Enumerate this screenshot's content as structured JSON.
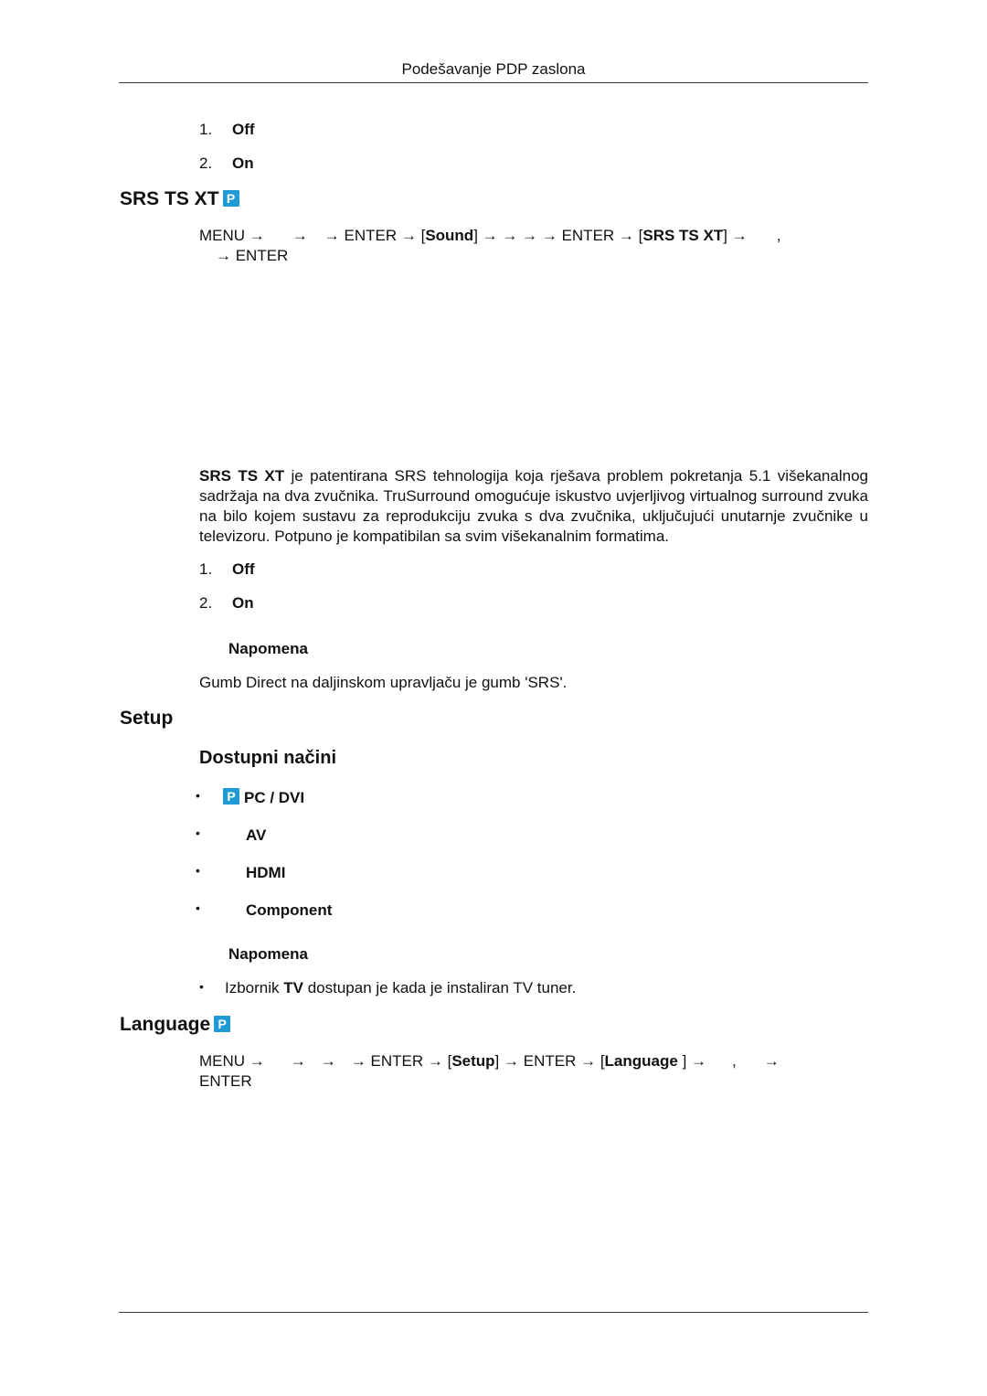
{
  "header": {
    "title": "Podešavanje PDP zaslona"
  },
  "top_options": [
    {
      "num": "1.",
      "label": "Off"
    },
    {
      "num": "2.",
      "label": "On"
    }
  ],
  "srs": {
    "title": "SRS TS XT",
    "badge": "P",
    "path": {
      "menu": "MENU →",
      "a1": "→",
      "a2": "→ ENTER →",
      "open1": "[",
      "sound": "Sound",
      "close1": "]",
      "a3": "→ → → → ENTER →",
      "open2": "[",
      "srs": "SRS TS XT",
      "close2": "]",
      "a4": "→",
      "comma": ",",
      "line2": "→ ENTER"
    },
    "description_bold": "SRS TS XT",
    "description": " je patentirana SRS tehnologija koja rješava problem pokretanja 5.1 višekanalnog sadržaja na dva zvučnika. TruSurround omogućuje iskustvo uvjerljivog virtualnog surround zvuka na bilo kojem sustavu za reprodukciju zvuka s dva zvučnika, uključujući unutarnje zvučnike u televizoru. Potpuno je kompatibilan sa svim višekanalnim formatima.",
    "options": [
      {
        "num": "1.",
        "label": "Off"
      },
      {
        "num": "2.",
        "label": "On"
      }
    ],
    "note_title": "Napomena",
    "note_text": "Gumb Direct na daljinskom upravljaču je gumb 'SRS'."
  },
  "setup": {
    "title": "Setup",
    "subtitle": "Dostupni načini",
    "modes": [
      {
        "label": "PC / DVI",
        "badge": "P"
      },
      {
        "label": "AV"
      },
      {
        "label": "HDMI"
      },
      {
        "label": "Component"
      }
    ],
    "note_title": "Napomena",
    "note_pre": "Izbornik ",
    "note_bold": "TV",
    "note_post": " dostupan je kada je instaliran TV tuner."
  },
  "language": {
    "title": "Language",
    "badge": "P",
    "path": {
      "menu": "MENU →",
      "a1": "→",
      "a2": "→",
      "a3": "→ ENTER →",
      "open1": "[",
      "setup": "Setup",
      "close1": "]",
      "a4": "→ ENTER →",
      "open2": "[",
      "language": "Language",
      "close2": "]",
      "a5": "→",
      "comma": ",",
      "a6": "→",
      "line2": "ENTER"
    }
  },
  "colors": {
    "badge": "#1f9ad6",
    "text": "#111111"
  }
}
